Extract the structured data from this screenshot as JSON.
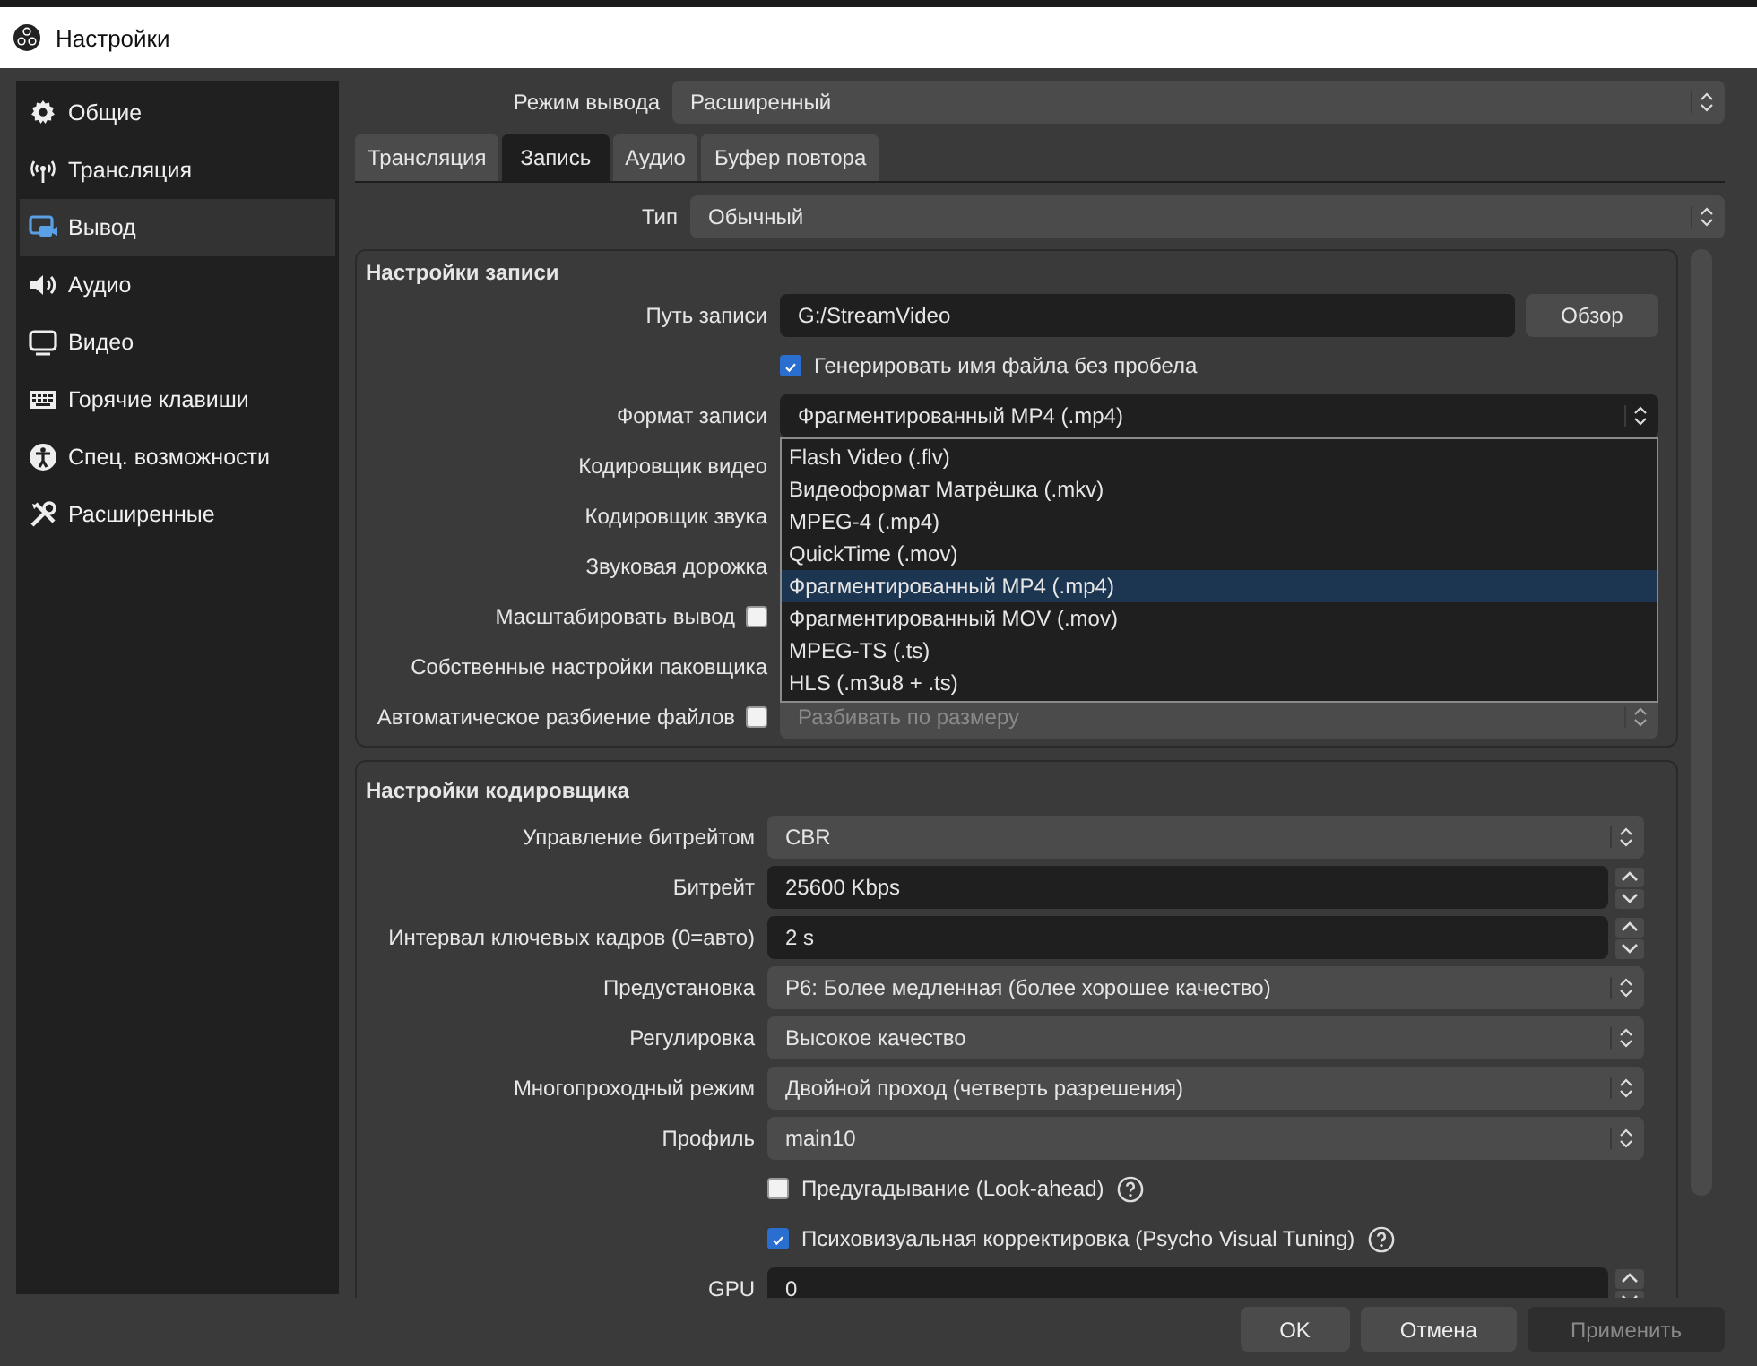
{
  "window": {
    "title": "Настройки"
  },
  "sidebar": {
    "items": [
      {
        "label": "Общие",
        "selected": false
      },
      {
        "label": "Трансляция",
        "selected": false
      },
      {
        "label": "Вывод",
        "selected": true
      },
      {
        "label": "Аудио",
        "selected": false
      },
      {
        "label": "Видео",
        "selected": false
      },
      {
        "label": "Горячие клавиши",
        "selected": false
      },
      {
        "label": "Спец. возможности",
        "selected": false
      },
      {
        "label": "Расширенные",
        "selected": false
      }
    ]
  },
  "output_mode": {
    "label": "Режим вывода",
    "value": "Расширенный"
  },
  "tabs": [
    {
      "label": "Трансляция",
      "selected": false
    },
    {
      "label": "Запись",
      "selected": true
    },
    {
      "label": "Аудио",
      "selected": false
    },
    {
      "label": "Буфер повтора",
      "selected": false
    }
  ],
  "type": {
    "label": "Тип",
    "value": "Обычный"
  },
  "recording": {
    "title": "Настройки записи",
    "rows": [
      {
        "kind": "path",
        "label": "Путь записи",
        "value": "G:/StreamVideo",
        "button": "Обзор"
      },
      {
        "kind": "check",
        "text": "Генерировать имя файла без пробела",
        "checked": true
      },
      {
        "kind": "select",
        "label": "Формат записи",
        "value": "Фрагментированный MP4 (.mp4)",
        "options": [
          {
            "text": "Flash Video (.flv)",
            "selected": false
          },
          {
            "text": "Видеоформат Матрёшка (.mkv)",
            "selected": false
          },
          {
            "text": "MPEG-4 (.mp4)",
            "selected": false
          },
          {
            "text": "QuickTime (.mov)",
            "selected": false
          },
          {
            "text": "Фрагментированный MP4 (.mp4)",
            "selected": true
          },
          {
            "text": "Фрагментированный MOV (.mov)",
            "selected": false
          },
          {
            "text": "MPEG-TS (.ts)",
            "selected": false
          },
          {
            "text": "HLS (.m3u8 + .ts)",
            "selected": false
          }
        ]
      },
      {
        "kind": "label",
        "label": "Кодировщик видео"
      },
      {
        "kind": "label",
        "label": "Кодировщик звука"
      },
      {
        "kind": "label",
        "label": "Звуковая дорожка"
      },
      {
        "kind": "label_check",
        "label": "Масштабировать вывод",
        "checked": false
      },
      {
        "kind": "label",
        "label": "Собственные настройки паковщика"
      },
      {
        "kind": "label_check",
        "label": "Автоматическое разбиение файлов",
        "checked": false,
        "select": {
          "value": "Разбивать по размеру",
          "disabled": true
        }
      }
    ]
  },
  "encoder": {
    "title": "Настройки кодировщика",
    "rows": [
      {
        "kind": "select",
        "label": "Управление битрейтом",
        "value": "CBR"
      },
      {
        "kind": "spin",
        "label": "Битрейт",
        "value": "25600 Kbps"
      },
      {
        "kind": "spin",
        "label": "Интервал ключевых кадров (0=авто)",
        "value": "2 s"
      },
      {
        "kind": "select",
        "label": "Предустановка",
        "value": "P6: Более медленная (более хорошее качество)"
      },
      {
        "kind": "select",
        "label": "Регулировка",
        "value": "Высокое качество"
      },
      {
        "kind": "select",
        "label": "Многопроходный режим",
        "value": "Двойной проход (четверть разрешения)"
      },
      {
        "kind": "select",
        "label": "Профиль",
        "value": "main10"
      },
      {
        "kind": "check",
        "text": "Предугадывание (Look-ahead)",
        "checked": false,
        "help": true
      },
      {
        "kind": "check",
        "text": "Психовизуальная корректировка (Psycho Visual Tuning)",
        "checked": true,
        "help": true
      },
      {
        "kind": "spin",
        "label": "GPU",
        "value": "0"
      }
    ]
  },
  "buttons": [
    {
      "label": "OK",
      "disabled": false
    },
    {
      "label": "Отмена",
      "disabled": false
    },
    {
      "label": "Применить",
      "disabled": true
    }
  ]
}
